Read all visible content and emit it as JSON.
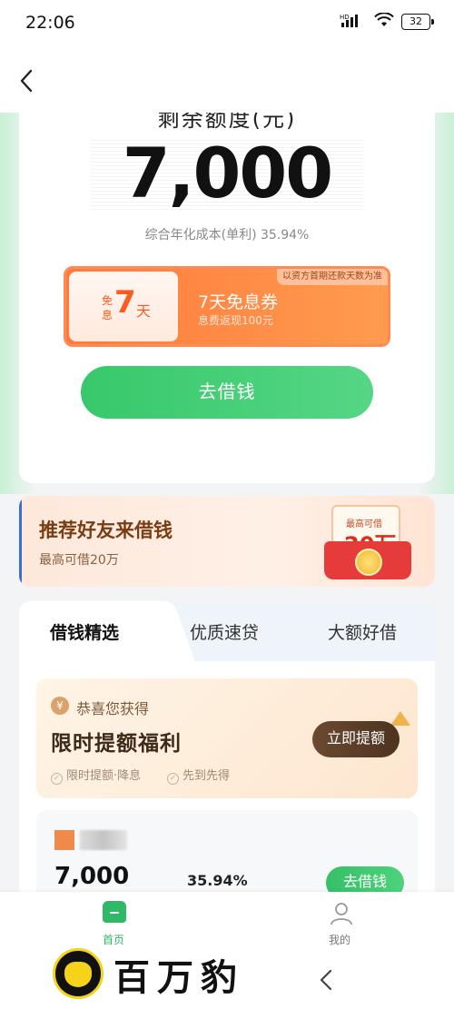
{
  "status_bar": {
    "time": "22:06",
    "battery": "32",
    "network_label": "HD"
  },
  "nav": {
    "back_icon": "chevron-left-icon"
  },
  "quota": {
    "label": "剩余额度(元)",
    "amount": "7,000",
    "apr_text": "综合年化成本(单利) 35.94%"
  },
  "coupon": {
    "left_mian": "免",
    "left_xi": "息",
    "days_num": "7",
    "days_unit": "天",
    "tag": "以资方首期还款天数为准",
    "title": "7天免息券",
    "subtitle": "息费返现100元"
  },
  "borrow_button": {
    "label": "去借钱"
  },
  "referral": {
    "title": "推荐好友来借钱",
    "subtitle": "最高可借20万",
    "envelope_tag": "最高可借",
    "envelope_amount": "20万"
  },
  "product_tabs": [
    {
      "label": "借钱精选",
      "active": true
    },
    {
      "label": "优质速贷",
      "active": false
    },
    {
      "label": "大额好借",
      "active": false
    }
  ],
  "promo": {
    "icon_text": "¥",
    "kicker": "恭喜您获得",
    "title": "限时提额福利",
    "feature_1": "限时提额·降息",
    "feature_2": "先到先得",
    "button": "立即提额"
  },
  "loan_item": {
    "amount": "7,000",
    "rate": "35.94%",
    "button": "去借钱"
  },
  "bottom_tabs": {
    "home": "首页",
    "me": "我的"
  },
  "watermark": {
    "brand": "百万豹"
  },
  "colors": {
    "primary_green": "#38c86b",
    "coupon_orange": "#ff7a3c",
    "promo_brown": "#4e3320"
  }
}
